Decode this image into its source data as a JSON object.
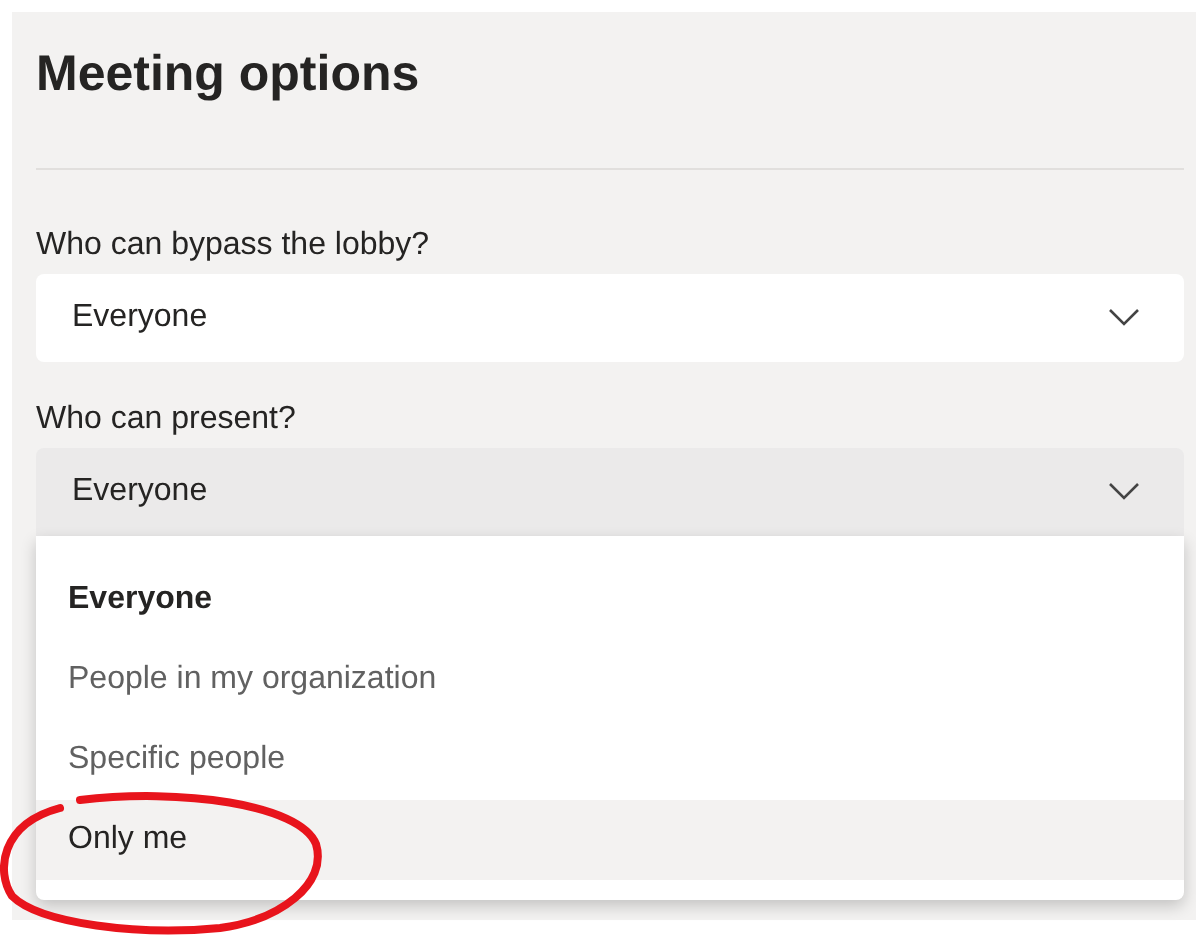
{
  "title": "Meeting options",
  "settings": [
    {
      "label": "Who can bypass the lobby?",
      "value": "Everyone",
      "expanded": false
    },
    {
      "label": "Who can present?",
      "value": "Everyone",
      "expanded": true,
      "options": [
        {
          "label": "Everyone",
          "selected": true,
          "hovered": false
        },
        {
          "label": "People in my organization",
          "selected": false,
          "hovered": false
        },
        {
          "label": "Specific people",
          "selected": false,
          "hovered": false
        },
        {
          "label": "Only me",
          "selected": false,
          "hovered": true
        }
      ]
    }
  ],
  "annotation": {
    "kind": "circle",
    "color": "#e8141c"
  }
}
